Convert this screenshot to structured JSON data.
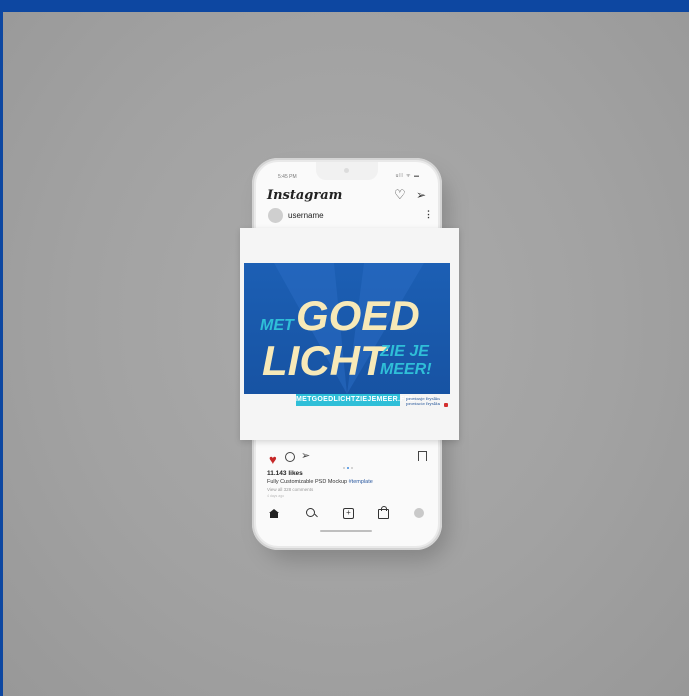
{
  "phone": {
    "status": {
      "time": "5:45 PM",
      "icons": "ull ᯤ ▬"
    },
    "header": {
      "logo": "Instagram",
      "chevron": "⌵"
    },
    "post": {
      "username": "username",
      "likes": "11.143 likes",
      "caption": "Fully Customizable PSD Mockup",
      "hashtag": "#template",
      "comments": "View all 328 comments",
      "time_ago": "4 days ago"
    }
  },
  "poster": {
    "line1_small": "MET",
    "line1_big": "GOED",
    "line2_big": "LICHT",
    "line2_small_a": "ZIE JE",
    "line2_small_b": "MEER!",
    "url": "METGOEDLICHTZIEJEMEER.FRL",
    "province_line1": "provinsje fryslân",
    "province_line2": "provincie fryslân"
  },
  "colors": {
    "background_border": "#0d47a1",
    "poster_blue": "#1c5fb4",
    "headline_cream": "#f7e9b8",
    "accent_cyan": "#2fbfd8",
    "like_red": "#c62828"
  }
}
